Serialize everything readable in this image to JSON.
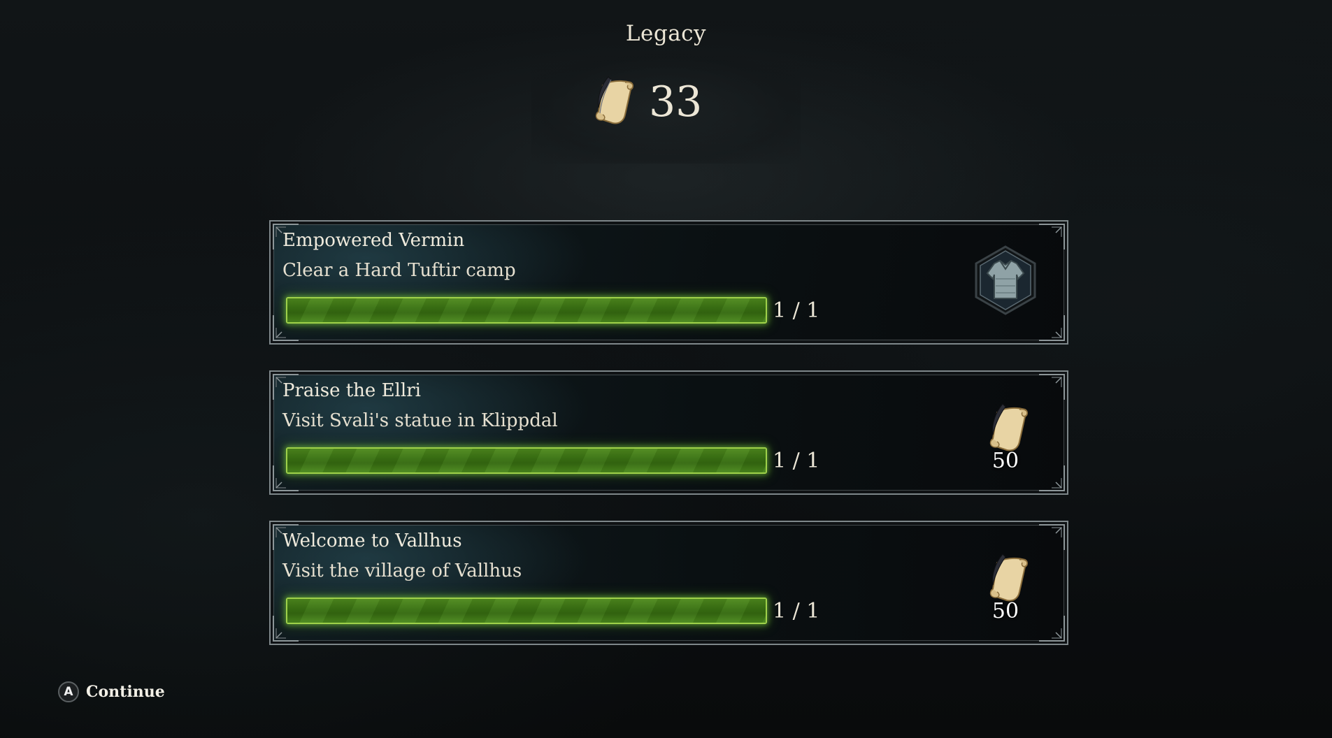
{
  "header": {
    "title": "Legacy",
    "currency_icon": "scroll-quill-icon",
    "currency_amount": "33"
  },
  "challenges": [
    {
      "name": "Empowered Vermin",
      "description": "Clear a Hard Tuftir camp",
      "progress_text": "1 / 1",
      "progress_fraction": 1.0,
      "reward_icon": "armor-tunic-icon",
      "reward_amount": ""
    },
    {
      "name": "Praise the Ellri",
      "description": "Visit Svali's statue in Klippdal",
      "progress_text": "1 / 1",
      "progress_fraction": 1.0,
      "reward_icon": "scroll-quill-icon",
      "reward_amount": "50"
    },
    {
      "name": "Welcome to Vallhus",
      "description": "Visit the village of Vallhus",
      "progress_text": "1 / 1",
      "progress_fraction": 1.0,
      "reward_icon": "scroll-quill-icon",
      "reward_amount": "50"
    }
  ],
  "footer": {
    "button_glyph": "A",
    "continue_label": "Continue"
  },
  "colors": {
    "progress_green": "#3b7413",
    "progress_glow": "#9fd14a",
    "frame": "#7e878a",
    "text": "#ece6d6"
  }
}
